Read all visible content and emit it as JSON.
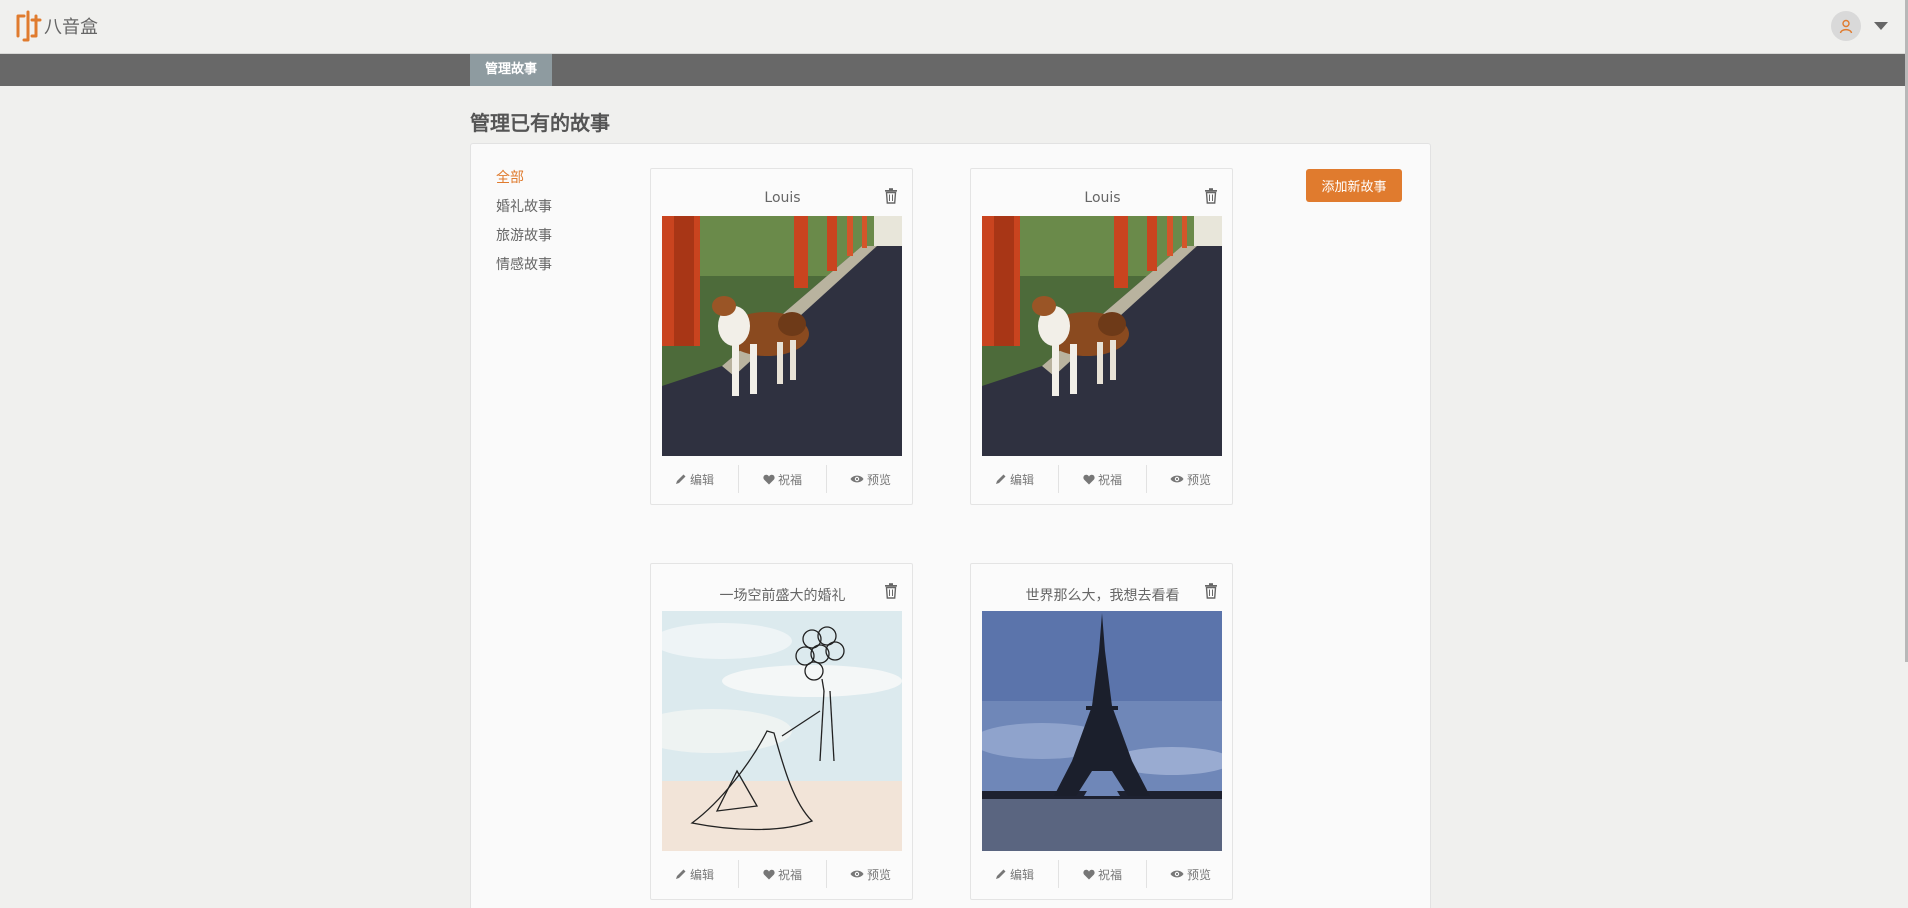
{
  "app": {
    "name": "八音盒"
  },
  "nav": {
    "tab": "管理故事"
  },
  "page": {
    "title": "管理已有的故事"
  },
  "categories": [
    "全部",
    "婚礼故事",
    "旅游故事",
    "情感故事"
  ],
  "add_button": "添加新故事",
  "actions": {
    "edit": "编辑",
    "bless": "祝福",
    "preview": "预览"
  },
  "stories": [
    {
      "title": "Louis",
      "image": "dog-photo"
    },
    {
      "title": "Louis",
      "image": "dog-photo"
    },
    {
      "title": "一场空前盛大的婚礼",
      "image": "wedding-sketch"
    },
    {
      "title": "世界那么大，我想去看看",
      "image": "eiffel-tower-photo"
    }
  ],
  "colors": {
    "accent": "#e07b2e",
    "navbar": "#686868",
    "nav_tab": "#8e9ba0"
  }
}
